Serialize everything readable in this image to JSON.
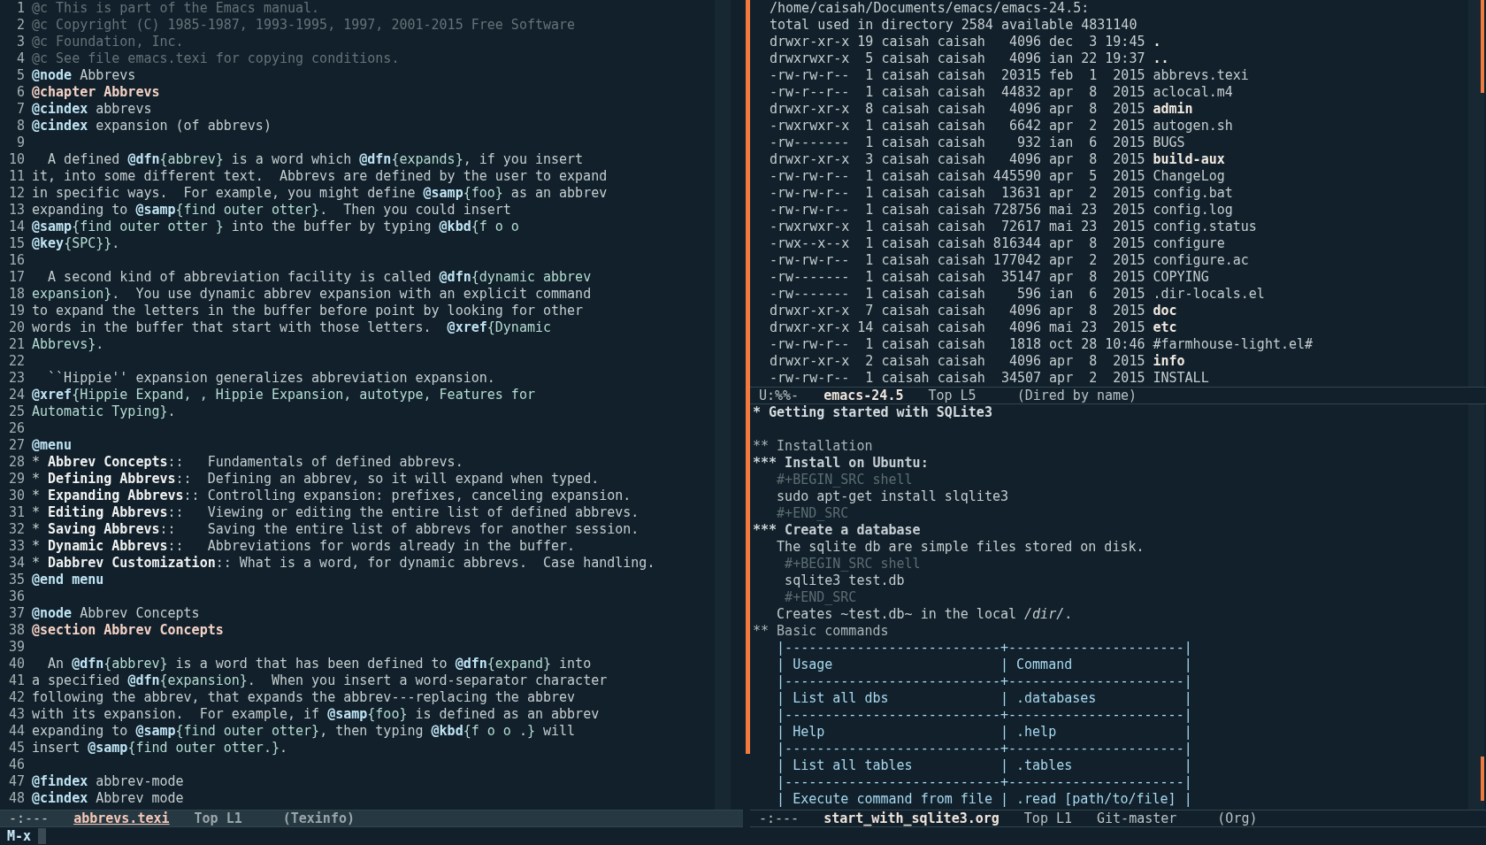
{
  "left_window": {
    "lines": [
      {
        "number": "1",
        "segments": [
          {
            "kind": "comment",
            "text": "@c This is part of the Emacs manual."
          }
        ]
      },
      {
        "number": "2",
        "segments": [
          {
            "kind": "comment",
            "text": "@c Copyright (C) 1985-1987, 1993-1995, 1997, 2001-2015 Free Software"
          }
        ]
      },
      {
        "number": "3",
        "segments": [
          {
            "kind": "comment",
            "text": "@c Foundation, Inc."
          }
        ]
      },
      {
        "number": "4",
        "segments": [
          {
            "kind": "comment",
            "text": "@c See file emacs.texi for copying conditions."
          }
        ]
      },
      {
        "number": "5",
        "segments": [
          {
            "kind": "keyword",
            "text": "@node"
          },
          {
            "kind": "text",
            "text": " Abbrevs"
          }
        ]
      },
      {
        "number": "6",
        "segments": [
          {
            "kind": "heading",
            "text": "@chapter Abbrevs"
          }
        ]
      },
      {
        "number": "7",
        "segments": [
          {
            "kind": "keyword",
            "text": "@cindex"
          },
          {
            "kind": "text",
            "text": " abbrevs"
          }
        ]
      },
      {
        "number": "8",
        "segments": [
          {
            "kind": "keyword",
            "text": "@cindex"
          },
          {
            "kind": "text",
            "text": " expansion (of abbrevs)"
          }
        ]
      },
      {
        "number": "9"
      },
      {
        "number": "10",
        "segments": [
          {
            "kind": "text",
            "text": "  A defined "
          },
          {
            "kind": "keyword",
            "text": "@dfn"
          },
          {
            "kind": "argument",
            "text": "{abbrev}"
          },
          {
            "kind": "text",
            "text": " is a word which "
          },
          {
            "kind": "keyword",
            "text": "@dfn"
          },
          {
            "kind": "argument",
            "text": "{expands}"
          },
          {
            "kind": "text",
            "text": ", if you insert"
          }
        ]
      },
      {
        "number": "11",
        "segments": [
          {
            "kind": "text",
            "text": "it, into some different text.  Abbrevs are defined by the user to expand"
          }
        ]
      },
      {
        "number": "12",
        "segments": [
          {
            "kind": "text",
            "text": "in specific ways.  For example, you might define "
          },
          {
            "kind": "keyword",
            "text": "@samp"
          },
          {
            "kind": "argument",
            "text": "{foo}"
          },
          {
            "kind": "text",
            "text": " as an abbrev"
          }
        ]
      },
      {
        "number": "13",
        "segments": [
          {
            "kind": "text",
            "text": "expanding to "
          },
          {
            "kind": "keyword",
            "text": "@samp"
          },
          {
            "kind": "argument",
            "text": "{find outer otter}"
          },
          {
            "kind": "text",
            "text": ".  Then you could insert"
          }
        ]
      },
      {
        "number": "14",
        "segments": [
          {
            "kind": "keyword",
            "text": "@samp"
          },
          {
            "kind": "argument",
            "text": "{find outer otter }"
          },
          {
            "kind": "text",
            "text": " into the buffer by typing "
          },
          {
            "kind": "keyword",
            "text": "@kbd"
          },
          {
            "kind": "argument",
            "text": "{f o o"
          }
        ]
      },
      {
        "number": "15",
        "segments": [
          {
            "kind": "keyword",
            "text": "@key"
          },
          {
            "kind": "argument",
            "text": "{SPC}}"
          },
          {
            "kind": "text",
            "text": "."
          }
        ]
      },
      {
        "number": "16"
      },
      {
        "number": "17",
        "segments": [
          {
            "kind": "text",
            "text": "  A second kind of abbreviation facility is called "
          },
          {
            "kind": "keyword",
            "text": "@dfn"
          },
          {
            "kind": "argument",
            "text": "{dynamic abbrev"
          }
        ]
      },
      {
        "number": "18",
        "segments": [
          {
            "kind": "argument",
            "text": "expansion}"
          },
          {
            "kind": "text",
            "text": ".  You use dynamic abbrev expansion with an explicit command"
          }
        ]
      },
      {
        "number": "19",
        "segments": [
          {
            "kind": "text",
            "text": "to expand the letters in the buffer before point by looking for other"
          }
        ]
      },
      {
        "number": "20",
        "segments": [
          {
            "kind": "text",
            "text": "words in the buffer that start with those letters.  "
          },
          {
            "kind": "keyword",
            "text": "@xref"
          },
          {
            "kind": "argument",
            "text": "{Dynamic"
          }
        ]
      },
      {
        "number": "21",
        "segments": [
          {
            "kind": "argument",
            "text": "Abbrevs}"
          },
          {
            "kind": "text",
            "text": "."
          }
        ]
      },
      {
        "number": "22"
      },
      {
        "number": "23",
        "segments": [
          {
            "kind": "text",
            "text": "  ``Hippie'' expansion generalizes abbreviation expansion."
          }
        ]
      },
      {
        "number": "24",
        "segments": [
          {
            "kind": "keyword",
            "text": "@xref"
          },
          {
            "kind": "argument",
            "text": "{Hippie Expand, , Hippie Expansion, autotype, Features for"
          }
        ]
      },
      {
        "number": "25",
        "segments": [
          {
            "kind": "argument",
            "text": "Automatic Typing}"
          },
          {
            "kind": "text",
            "text": "."
          }
        ]
      },
      {
        "number": "26"
      },
      {
        "number": "27",
        "segments": [
          {
            "kind": "keyword",
            "text": "@menu"
          }
        ]
      },
      {
        "number": "28",
        "segments": [
          {
            "kind": "text",
            "text": "* "
          },
          {
            "kind": "menu_item",
            "text": "Abbrev Concepts"
          },
          {
            "kind": "text",
            "text": "::   Fundamentals of defined abbrevs."
          }
        ]
      },
      {
        "number": "29",
        "segments": [
          {
            "kind": "text",
            "text": "* "
          },
          {
            "kind": "menu_item",
            "text": "Defining Abbrevs"
          },
          {
            "kind": "text",
            "text": "::  Defining an abbrev, so it will expand when typed."
          }
        ]
      },
      {
        "number": "30",
        "segments": [
          {
            "kind": "text",
            "text": "* "
          },
          {
            "kind": "menu_item",
            "text": "Expanding Abbrevs"
          },
          {
            "kind": "text",
            "text": ":: Controlling expansion: prefixes, canceling expansion."
          }
        ]
      },
      {
        "number": "31",
        "segments": [
          {
            "kind": "text",
            "text": "* "
          },
          {
            "kind": "menu_item",
            "text": "Editing Abbrevs"
          },
          {
            "kind": "text",
            "text": "::   Viewing or editing the entire list of defined abbrevs."
          }
        ]
      },
      {
        "number": "32",
        "segments": [
          {
            "kind": "text",
            "text": "* "
          },
          {
            "kind": "menu_item",
            "text": "Saving Abbrevs"
          },
          {
            "kind": "text",
            "text": "::    Saving the entire list of abbrevs for another session."
          }
        ]
      },
      {
        "number": "33",
        "segments": [
          {
            "kind": "text",
            "text": "* "
          },
          {
            "kind": "menu_item",
            "text": "Dynamic Abbrevs"
          },
          {
            "kind": "text",
            "text": "::   Abbreviations for words already in the buffer."
          }
        ]
      },
      {
        "number": "34",
        "segments": [
          {
            "kind": "text",
            "text": "* "
          },
          {
            "kind": "menu_item",
            "text": "Dabbrev Customization"
          },
          {
            "kind": "text",
            "text": ":: What is a word, for dynamic abbrevs.  Case handling."
          }
        ]
      },
      {
        "number": "35",
        "segments": [
          {
            "kind": "keyword",
            "text": "@end menu"
          }
        ]
      },
      {
        "number": "36"
      },
      {
        "number": "37",
        "segments": [
          {
            "kind": "keyword",
            "text": "@node"
          },
          {
            "kind": "text",
            "text": " Abbrev Concepts"
          }
        ]
      },
      {
        "number": "38",
        "segments": [
          {
            "kind": "heading",
            "text": "@section Abbrev Concepts"
          }
        ]
      },
      {
        "number": "39"
      },
      {
        "number": "40",
        "segments": [
          {
            "kind": "text",
            "text": "  An "
          },
          {
            "kind": "keyword",
            "text": "@dfn"
          },
          {
            "kind": "argument",
            "text": "{abbrev}"
          },
          {
            "kind": "text",
            "text": " is a word that has been defined to "
          },
          {
            "kind": "keyword",
            "text": "@dfn"
          },
          {
            "kind": "argument",
            "text": "{expand}"
          },
          {
            "kind": "text",
            "text": " into"
          }
        ]
      },
      {
        "number": "41",
        "segments": [
          {
            "kind": "text",
            "text": "a specified "
          },
          {
            "kind": "keyword",
            "text": "@dfn"
          },
          {
            "kind": "argument",
            "text": "{expansion}"
          },
          {
            "kind": "text",
            "text": ".  When you insert a word-separator character"
          }
        ]
      },
      {
        "number": "42",
        "segments": [
          {
            "kind": "text",
            "text": "following the abbrev, that expands the abbrev---replacing the abbrev"
          }
        ]
      },
      {
        "number": "43",
        "segments": [
          {
            "kind": "text",
            "text": "with its expansion.  For example, if "
          },
          {
            "kind": "keyword",
            "text": "@samp"
          },
          {
            "kind": "argument",
            "text": "{foo}"
          },
          {
            "kind": "text",
            "text": " is defined as an abbrev"
          }
        ]
      },
      {
        "number": "44",
        "segments": [
          {
            "kind": "text",
            "text": "expanding to "
          },
          {
            "kind": "keyword",
            "text": "@samp"
          },
          {
            "kind": "argument",
            "text": "{find outer otter}"
          },
          {
            "kind": "text",
            "text": ", then typing "
          },
          {
            "kind": "keyword",
            "text": "@kbd"
          },
          {
            "kind": "argument",
            "text": "{f o o .}"
          },
          {
            "kind": "text",
            "text": " will"
          }
        ]
      },
      {
        "number": "45",
        "segments": [
          {
            "kind": "text",
            "text": "insert "
          },
          {
            "kind": "keyword",
            "text": "@samp"
          },
          {
            "kind": "argument",
            "text": "{find outer otter.}"
          },
          {
            "kind": "text",
            "text": "."
          }
        ]
      },
      {
        "number": "46"
      },
      {
        "number": "47",
        "segments": [
          {
            "kind": "keyword",
            "text": "@findex"
          },
          {
            "kind": "text",
            "text": " abbrev-mode"
          }
        ]
      },
      {
        "number": "48",
        "segments": [
          {
            "kind": "keyword",
            "text": "@cindex"
          },
          {
            "kind": "text",
            "text": " Abbrev mode"
          }
        ]
      }
    ],
    "mode_line": {
      "active": true,
      "fields": [
        {
          "kind": "status",
          "text": "-:---"
        },
        {
          "kind": "buffer",
          "text": "abbrevs.texi"
        },
        {
          "kind": "position",
          "text": "Top L1"
        },
        {
          "kind": "mode",
          "text": "(Texinfo)"
        }
      ]
    }
  },
  "right_top_window": {
    "header": [
      "/home/caisah/Documents/emacs/emacs-24.5:",
      "total used in directory 2584 available 4831140"
    ],
    "entries": [
      {
        "details": "drwxr-xr-x 19 caisah caisah   4096 dec  3 19:45",
        "name": ".",
        "directory": true
      },
      {
        "details": "drwxrwxr-x  5 caisah caisah   4096 ian 22 19:37",
        "name": "..",
        "directory": true
      },
      {
        "details": "-rw-rw-r--  1 caisah caisah  20315 feb  1  2015",
        "name": "abbrevs.texi",
        "directory": false
      },
      {
        "details": "-rw-r--r--  1 caisah caisah  44832 apr  8  2015",
        "name": "aclocal.m4",
        "directory": false
      },
      {
        "details": "drwxr-xr-x  8 caisah caisah   4096 apr  8  2015",
        "name": "admin",
        "directory": true
      },
      {
        "details": "-rwxrwxr-x  1 caisah caisah   6642 apr  2  2015",
        "name": "autogen.sh",
        "directory": false
      },
      {
        "details": "-rw-------  1 caisah caisah    932 ian  6  2015",
        "name": "BUGS",
        "directory": false
      },
      {
        "details": "drwxr-xr-x  3 caisah caisah   4096 apr  8  2015",
        "name": "build-aux",
        "directory": true
      },
      {
        "details": "-rw-rw-r--  1 caisah caisah 445590 apr  5  2015",
        "name": "ChangeLog",
        "directory": false
      },
      {
        "details": "-rw-rw-r--  1 caisah caisah  13631 apr  2  2015",
        "name": "config.bat",
        "directory": false
      },
      {
        "details": "-rw-rw-r--  1 caisah caisah 728756 mai 23  2015",
        "name": "config.log",
        "directory": false
      },
      {
        "details": "-rwxrwxr-x  1 caisah caisah  72617 mai 23  2015",
        "name": "config.status",
        "directory": false
      },
      {
        "details": "-rwx--x--x  1 caisah caisah 816344 apr  8  2015",
        "name": "configure",
        "directory": false
      },
      {
        "details": "-rw-rw-r--  1 caisah caisah 177042 apr  2  2015",
        "name": "configure.ac",
        "directory": false
      },
      {
        "details": "-rw-------  1 caisah caisah  35147 apr  8  2015",
        "name": "COPYING",
        "directory": false
      },
      {
        "details": "-rw-------  1 caisah caisah    596 ian  6  2015",
        "name": ".dir-locals.el",
        "directory": false
      },
      {
        "details": "drwxr-xr-x  7 caisah caisah   4096 apr  8  2015",
        "name": "doc",
        "directory": true
      },
      {
        "details": "drwxr-xr-x 14 caisah caisah   4096 mai 23  2015",
        "name": "etc",
        "directory": true
      },
      {
        "details": "-rw-rw-r--  1 caisah caisah   1818 oct 28 10:46",
        "name": "#farmhouse-light.el#",
        "directory": false
      },
      {
        "details": "drwxr-xr-x  2 caisah caisah   4096 apr  8  2015",
        "name": "info",
        "directory": true
      },
      {
        "details": "-rw-rw-r--  1 caisah caisah  34507 apr  2  2015",
        "name": "INSTALL",
        "directory": false
      }
    ],
    "mode_line": {
      "active": false,
      "fields": [
        {
          "kind": "status",
          "text": "U:%%-"
        },
        {
          "kind": "buffer",
          "text": "emacs-24.5"
        },
        {
          "kind": "position",
          "text": "Top L5"
        },
        {
          "kind": "mode",
          "text": "(Dired by name)"
        }
      ]
    }
  },
  "right_bottom_window": {
    "lines": [
      {
        "kind": "title",
        "text": "* Getting started with SQLite3"
      },
      {
        "kind": "blank"
      },
      {
        "kind": "heading2",
        "text": "** Installation"
      },
      {
        "kind": "heading3",
        "text": "*** Install on Ubuntu:"
      },
      {
        "kind": "meta",
        "text": "   #+BEGIN_SRC shell"
      },
      {
        "kind": "body",
        "text": "   sudo apt-get install slqlite3"
      },
      {
        "kind": "meta",
        "text": "   #+END_SRC"
      },
      {
        "kind": "heading3",
        "text": "*** Create a database"
      },
      {
        "kind": "body",
        "text": "   The sqlite db are simple files stored on disk."
      },
      {
        "kind": "meta",
        "text": "    #+BEGIN_SRC shell"
      },
      {
        "kind": "body",
        "text": "    sqlite3 test.db"
      },
      {
        "kind": "meta",
        "text": "    #+END_SRC"
      },
      {
        "kind": "body",
        "text": "   Creates ~test.db~ in the local */dir/*."
      },
      {
        "kind": "heading2",
        "text": "** Basic commands"
      },
      {
        "kind": "table",
        "text": "   |---------------------------+----------------------|"
      },
      {
        "kind": "table",
        "text": "   | Usage                     | Command              |"
      },
      {
        "kind": "table",
        "text": "   |---------------------------+----------------------|"
      },
      {
        "kind": "table",
        "text": "   | List all dbs              | .databases           |"
      },
      {
        "kind": "table",
        "text": "   |---------------------------+----------------------|"
      },
      {
        "kind": "table",
        "text": "   | Help                      | .help                |"
      },
      {
        "kind": "table",
        "text": "   |---------------------------+----------------------|"
      },
      {
        "kind": "table",
        "text": "   | List all tables           | .tables              |"
      },
      {
        "kind": "table",
        "text": "   |---------------------------+----------------------|"
      },
      {
        "kind": "table",
        "text": "   | Execute command from file | .read [path/to/file] |"
      }
    ],
    "mode_line": {
      "active": false,
      "fields": [
        {
          "kind": "status",
          "text": "-:---"
        },
        {
          "kind": "buffer",
          "text": "start_with_sqlite3.org"
        },
        {
          "kind": "position",
          "text": "Top L1"
        },
        {
          "kind": "branch",
          "text": "Git-master"
        },
        {
          "kind": "mode",
          "text": "(Org)"
        }
      ]
    }
  },
  "minibuffer": {
    "prompt": "M-x"
  }
}
